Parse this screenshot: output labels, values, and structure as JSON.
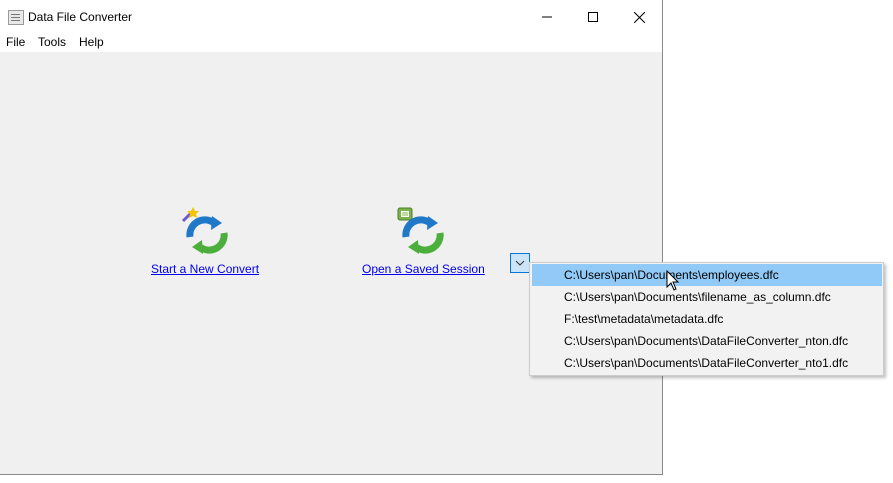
{
  "window": {
    "title": "Data File Converter"
  },
  "menu": [
    {
      "label": "File"
    },
    {
      "label": "Tools"
    },
    {
      "label": "Help"
    }
  ],
  "actions": {
    "new_convert_label": "Start a New Convert",
    "open_session_label": "Open a Saved Session"
  },
  "recent_files": {
    "items": [
      {
        "path": "C:\\Users\\pan\\Documents\\employees.dfc",
        "selected": true
      },
      {
        "path": "C:\\Users\\pan\\Documents\\filename_as_column.dfc",
        "selected": false
      },
      {
        "path": "F:\\test\\metadata\\metadata.dfc",
        "selected": false
      },
      {
        "path": "C:\\Users\\pan\\Documents\\DataFileConverter_nton.dfc",
        "selected": false
      },
      {
        "path": "C:\\Users\\pan\\Documents\\DataFileConverter_nto1.dfc",
        "selected": false
      }
    ]
  },
  "icons": {
    "app": "app-window-icon",
    "minimize": "minimize-icon",
    "maximize": "maximize-icon",
    "close": "close-icon",
    "new_convert": "refresh-wand-icon",
    "open_session": "refresh-document-icon",
    "dropdown": "chevron-down-icon",
    "cursor": "mouse-pointer-icon"
  },
  "colors": {
    "selection": "#91c9f7",
    "link": "#0000ee",
    "client_bg": "#f0f0f0",
    "dropdown_button_bg": "#cce4f7",
    "dropdown_button_border": "#0078d7"
  }
}
